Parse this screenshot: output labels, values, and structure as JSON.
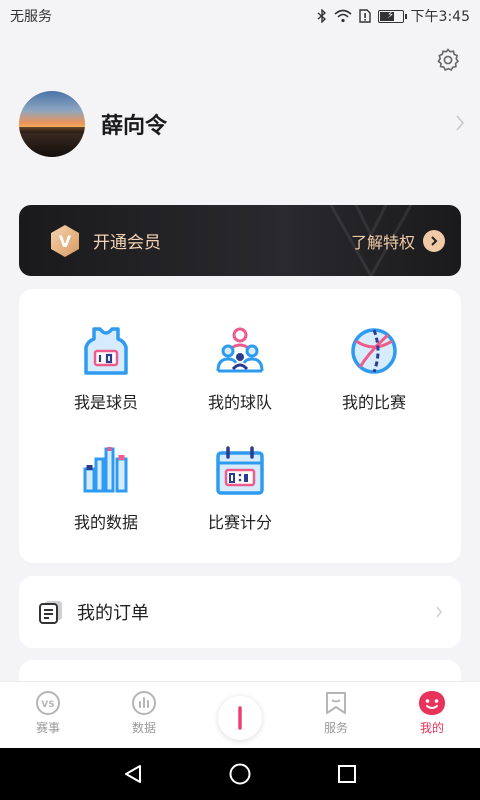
{
  "status_bar": {
    "carrier": "无服务",
    "time": "下午3:45",
    "battery_level": 0.6
  },
  "profile": {
    "name": "薛向令"
  },
  "vip": {
    "badge_letter": "V",
    "title": "开通会员",
    "more_label": "了解特权"
  },
  "grid": {
    "items": [
      {
        "label": "我是球员",
        "icon": "jersey-icon"
      },
      {
        "label": "我的球队",
        "icon": "team-icon"
      },
      {
        "label": "我的比赛",
        "icon": "basketball-icon"
      },
      {
        "label": "我的数据",
        "icon": "bar-chart-icon"
      },
      {
        "label": "比赛计分",
        "icon": "scoreboard-icon"
      }
    ]
  },
  "order": {
    "label": "我的订单"
  },
  "tabs": [
    {
      "label": "赛事",
      "icon": "vs-icon"
    },
    {
      "label": "数据",
      "icon": "data-icon"
    },
    {
      "label": "",
      "icon": "plus-icon"
    },
    {
      "label": "服务",
      "icon": "bookmark-icon"
    },
    {
      "label": "我的",
      "icon": "smiley-icon",
      "active": true
    }
  ],
  "colors": {
    "accent": "#e8335a",
    "blue": "#2e9bf0",
    "pink": "#ef5b8a",
    "navy": "#2c3d8f",
    "gold": "#f0c9a6"
  }
}
